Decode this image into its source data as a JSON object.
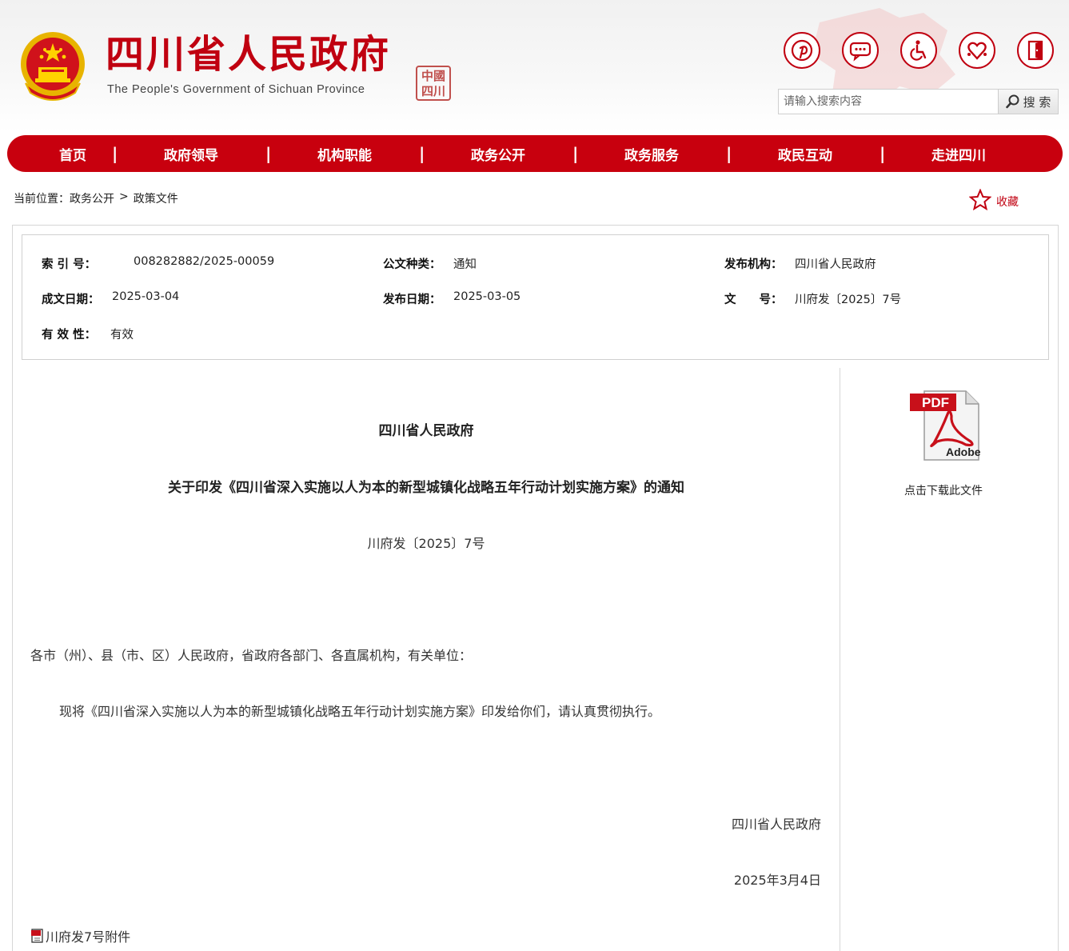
{
  "header": {
    "title": "四川省人民政府",
    "subtitle": "The People's Government of Sichuan Province",
    "seal_text": "中國四川",
    "quick_icons": [
      "pinterest-style-icon",
      "message-icon",
      "accessibility-icon",
      "heart-hands-icon",
      "exit-door-icon"
    ],
    "search": {
      "placeholder": "请输入搜索内容",
      "button_label": "搜 索"
    }
  },
  "nav": {
    "items": [
      "首页",
      "政府领导",
      "机构职能",
      "政务公开",
      "政务服务",
      "政民互动",
      "走进四川"
    ],
    "separator": "|"
  },
  "breadcrumb": {
    "prefix": "当前位置：",
    "items": [
      "政务公开",
      "政策文件"
    ],
    "separator": ">"
  },
  "favorite_label": "收藏",
  "meta": {
    "index_label": "索 引 号：",
    "index_value": "008282882/2025-00059",
    "doctype_label": "公文种类：",
    "doctype_value": "通知",
    "publisher_label": "发布机构：",
    "publisher_value": "四川省人民政府",
    "created_label": "成文日期：",
    "created_value": "2025-03-04",
    "published_label": "发布日期：",
    "published_value": "2025-03-05",
    "docno_label": "文　　号：",
    "docno_value": "川府发〔2025〕7号",
    "validity_label": "有 效 性：",
    "validity_value": "有效"
  },
  "document": {
    "title_line1": "四川省人民政府",
    "title_line2": "关于印发《四川省深入实施以人为本的新型城镇化战略五年行动计划实施方案》的通知",
    "doc_number": "川府发〔2025〕7号",
    "salutation": "各市（州）、县（市、区）人民政府，省政府各部门、各直属机构，有关单位：",
    "body": "现将《四川省深入实施以人为本的新型城镇化战略五年行动计划实施方案》印发给你们，请认真贯彻执行。",
    "signature": "四川省人民政府",
    "date": "2025年3月4日",
    "attachment": "川府发7号附件"
  },
  "download": {
    "pdf_badge": "PDF",
    "pdf_brand": "Adobe",
    "label": "点击下载此文件"
  },
  "colors": {
    "brand_red": "#c8000e",
    "text": "#222222"
  }
}
